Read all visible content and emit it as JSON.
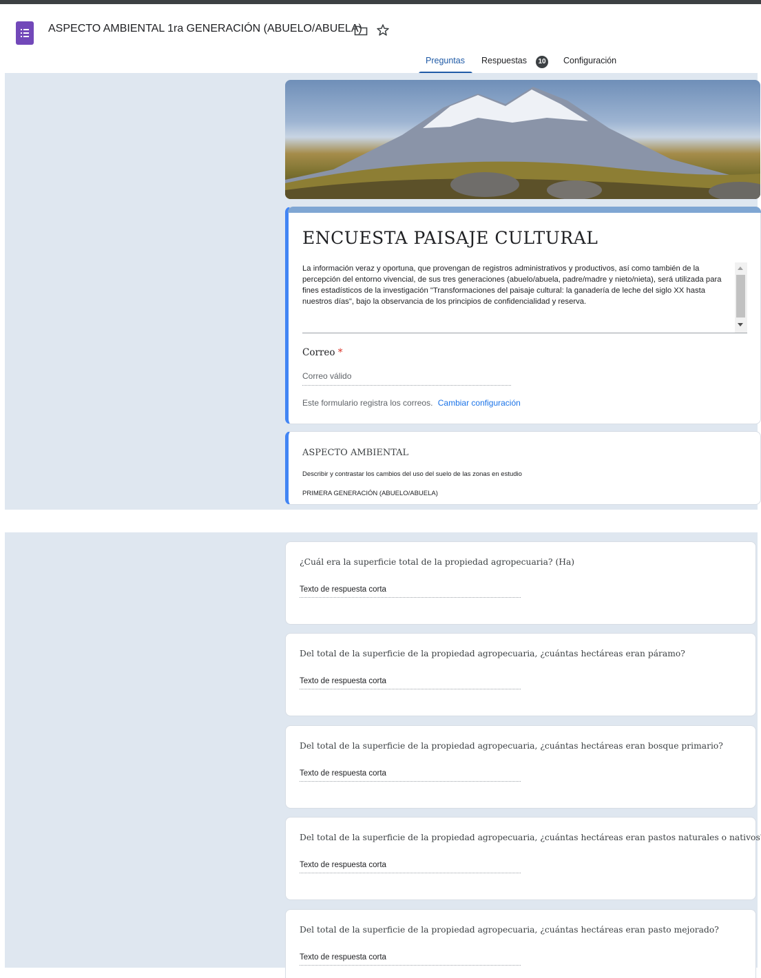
{
  "header": {
    "doc_title": "ASPECTO AMBIENTAL 1ra GENERACIÓN (ABUELO/ABUELA)",
    "tabs": [
      {
        "label": "Preguntas",
        "active": true
      },
      {
        "label": "Respuestas",
        "badge": "10"
      },
      {
        "label": "Configuración"
      }
    ]
  },
  "form": {
    "title": "ENCUESTA PAISAJE CULTURAL",
    "description": "La información veraz y oportuna, que provengan de registros administrativos y productivos, así como también de la percepción del entorno vivencial, de sus tres generaciones (abuelo/abuela, padre/madre y nieto/nieta), será utilizada para fines estadísticos de la investigación \"Transformaciones del paisaje cultural: la ganadería de leche del siglo XX hasta nuestros días\", bajo la observancia de los principios de confidencialidad y reserva.",
    "email_label": "Correo",
    "email_required_mark": "*",
    "email_placeholder": "Correo válido",
    "email_note": "Este formulario registra los correos.",
    "email_link": "Cambiar configuración"
  },
  "section": {
    "title": "ASPECTO AMBIENTAL",
    "subtitle": "Describir y contrastar los cambios del uso del suelo de las zonas en estudio",
    "generation": "PRIMERA GENERACIÓN (ABUELO/ABUELA)"
  },
  "questions": [
    {
      "title": "¿Cuál era la superficie total de la propiedad agropecuaria? (Ha)",
      "placeholder": "Texto de respuesta corta"
    },
    {
      "title": "Del total de la superficie de la propiedad agropecuaria, ¿cuántas hectáreas eran páramo?",
      "placeholder": "Texto de respuesta corta"
    },
    {
      "title": "Del total de la superficie de la propiedad agropecuaria, ¿cuántas hectáreas eran bosque primario?",
      "placeholder": "Texto de respuesta corta"
    },
    {
      "title": "Del total de la superficie de la propiedad agropecuaria, ¿cuántas hectáreas eran pastos naturales o nativos?",
      "placeholder": "Texto de respuesta corta"
    },
    {
      "title": "Del total de la superficie de la propiedad agropecuaria, ¿cuántas hectáreas eran pasto mejorado?",
      "placeholder": "Texto de respuesta corta"
    }
  ],
  "colors": {
    "accent": "#1f5aa6",
    "app_icon": "#7248b9",
    "background": "#dfe7f0",
    "selected_bar": "#4285f4",
    "link": "#1a73e8",
    "required": "#d93025"
  },
  "icons": {
    "app": "google-forms-icon",
    "folder": "folder-icon",
    "star": "star-icon"
  }
}
